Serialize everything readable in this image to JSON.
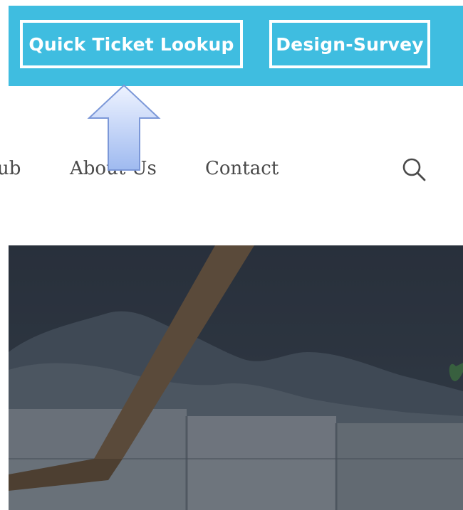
{
  "header": {
    "buttons": [
      {
        "label": "Quick Ticket Lookup"
      },
      {
        "label": "Design-Survey"
      }
    ],
    "accent_color": "#3fbde0"
  },
  "nav": {
    "items": [
      {
        "label": "ub"
      },
      {
        "label": "About Us"
      },
      {
        "label": "Contact"
      }
    ],
    "search_icon": "search-icon"
  },
  "annotation": {
    "arrow_icon": "up-arrow-icon",
    "arrow_color": "#9fbaf0"
  },
  "hero": {
    "image": "hero-photo"
  }
}
